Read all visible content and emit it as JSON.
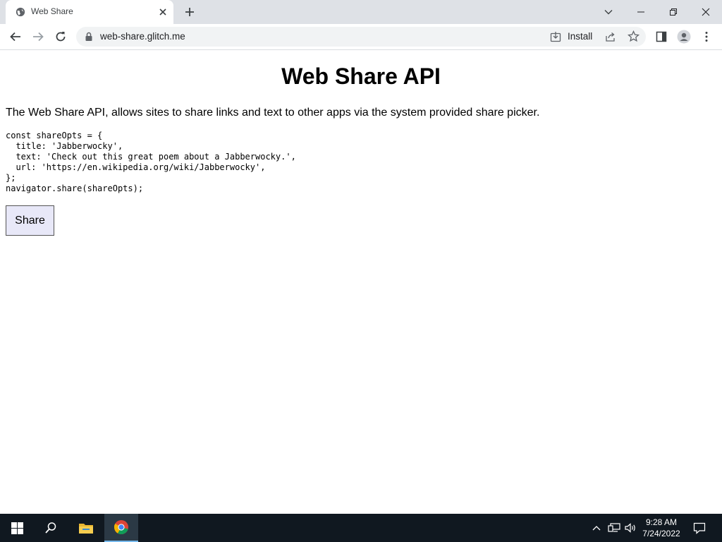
{
  "browser": {
    "tab": {
      "title": "Web Share"
    },
    "address_bar": {
      "url": "web-share.glitch.me"
    },
    "install_label": "Install"
  },
  "page": {
    "title": "Web Share API",
    "intro": "The Web Share API, allows sites to share links and text to other apps via the system provided share picker.",
    "code": "const shareOpts = {\n  title: 'Jabberwocky',\n  text: 'Check out this great poem about a Jabberwocky.',\n  url: 'https://en.wikipedia.org/wiki/Jabberwocky',\n};\nnavigator.share(shareOpts);",
    "share_button_label": "Share"
  },
  "taskbar": {
    "time": "9:28 AM",
    "date": "7/24/2022"
  },
  "colors": {
    "tabstrip": "#dee1e6",
    "taskbar": "#101820",
    "share_button_bg": "#e8e8f8"
  }
}
